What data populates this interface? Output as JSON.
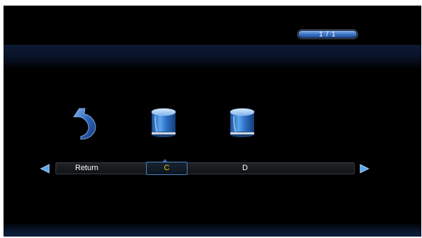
{
  "pager": {
    "text": "1 / 1",
    "progress": 1.0
  },
  "items": [
    {
      "label": "Return",
      "icon": "return-arrow-icon"
    },
    {
      "label": "C",
      "icon": "drive-icon",
      "selected": true
    },
    {
      "label": "D",
      "icon": "drive-icon"
    }
  ],
  "colors": {
    "background": "#000000",
    "accent_blue": "#3b73c6",
    "selected_text": "#f0c800",
    "text": "#ffffff"
  }
}
